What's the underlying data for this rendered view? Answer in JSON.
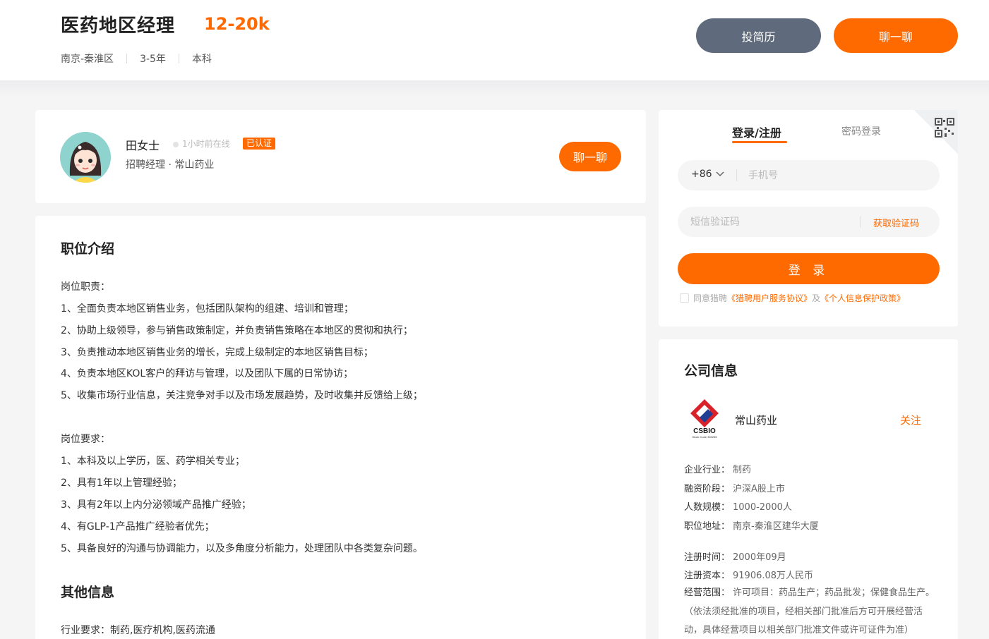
{
  "job": {
    "title": "医药地区经理",
    "salary": "12-20k",
    "location": "南京-秦淮区",
    "experience": "3-5年",
    "education": "本科"
  },
  "header_actions": {
    "resume_label": "投简历",
    "chat_label": "聊一聊"
  },
  "recruiter": {
    "name": "田女士",
    "online_status": "1小时前在线",
    "verified_label": "已认证",
    "role": "招聘经理 · 常山药业",
    "chat_label": "聊一聊"
  },
  "description": {
    "section_title": "职位介绍",
    "duties_heading": "岗位职责：",
    "duties": [
      "1、全面负责本地区销售业务，包括团队架构的组建、培训和管理；",
      "2、协助上级领导，参与销售政策制定，并负责销售策略在本地区的贯彻和执行；",
      "3、负责推动本地区销售业务的增长，完成上级制定的本地区销售目标；",
      "4、负责本地区KOL客户的拜访与管理，以及团队下属的日常协访；",
      "5、收集市场行业信息，关注竞争对手以及市场发展趋势，及时收集并反馈给上级；"
    ],
    "requirements_heading": "岗位要求：",
    "requirements": [
      "1、本科及以上学历，医、药学相关专业；",
      "2、具有1年以上管理经验；",
      "3、具有2年以上内分泌领域产品推广经验；",
      "4、有GLP-1产品推广经验者优先；",
      "5、具备良好的沟通与协调能力，以及多角度分析能力，处理团队中各类复杂问题。"
    ],
    "other_title": "其他信息",
    "industry_requirement": "行业要求：制药,医疗机构,医药流通"
  },
  "login": {
    "tab_active": "登录/注册",
    "tab_password": "密码登录",
    "country_code": "+86",
    "phone_placeholder": "手机号",
    "sms_placeholder": "短信验证码",
    "get_code_label": "获取验证码",
    "login_button": "登 录",
    "agree_prefix": "同意猎聘",
    "agree_link1": "《猎聘用户服务协议》",
    "agree_and": "及",
    "agree_link2": "《个人信息保护政策》"
  },
  "company": {
    "section_title": "公司信息",
    "name": "常山药业",
    "follow_label": "关注",
    "logo_text": "CSBIO",
    "logo_subtext": "Stock Code 300255",
    "industry_label": "企业行业：",
    "industry": "制药",
    "funding_label": "融资阶段：",
    "funding": "沪深A股上市",
    "size_label": "人数规模：",
    "size": "1000-2000人",
    "address_label": "职位地址：",
    "address": "南京-秦淮区建华大厦",
    "registered_label": "注册时间：",
    "registered": "2000年09月",
    "capital_label": "注册资本：",
    "capital": "91906.08万人民币",
    "scope_label": "经营范围：",
    "scope": "许可项目：药品生产；药品批发；保健食品生产。（依法须经批准的项目，经相关部门批准后方可开展经营活动，具体经营项目以相关部门批准文件或许可证件为准）"
  },
  "colors": {
    "accent": "#ff6a00",
    "resume_button": "#5f6b7c",
    "background": "#f5f5f6"
  }
}
